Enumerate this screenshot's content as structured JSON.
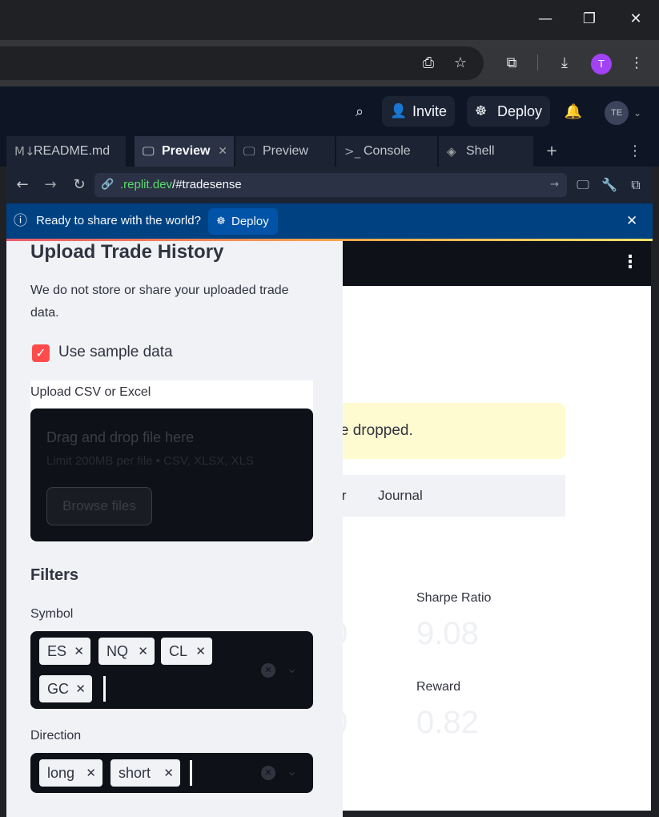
{
  "replit": {
    "invite_label": "Invite",
    "deploy_label": "Deploy",
    "avatar_initials": "TE",
    "tabs": [
      {
        "label": "README.md"
      },
      {
        "label": "Preview"
      },
      {
        "label": "Preview"
      },
      {
        "label": "Console"
      },
      {
        "label": "Shell"
      }
    ],
    "url_host": ".replit.dev",
    "url_path": "/#tradesense"
  },
  "browser": {
    "profile_initial": "T"
  },
  "banner": {
    "text": "Ready to share with the world?",
    "deploy_label": "Deploy"
  },
  "sidebar": {
    "title": "Upload Trade History",
    "note": "We do not store or share your uploaded trade data.",
    "sample_checkbox_label": "Use sample data",
    "sample_checked": true,
    "upload_label": "Upload CSV or Excel",
    "dropzone_title": "Drag and drop file here",
    "dropzone_limit": "Limit 200MB per file • CSV, XLSX, XLS",
    "browse_label": "Browse files",
    "filters_heading": "Filters",
    "symbol_label": "Symbol",
    "symbols": [
      "ES",
      "NQ",
      "CL",
      "GC"
    ],
    "direction_label": "Direction",
    "directions": [
      "long",
      "short"
    ]
  },
  "main": {
    "warning_partial": "ere dropped.",
    "tab_partial": "dar",
    "tab_journal": "Journal",
    "metric1_label": "Sharpe Ratio",
    "metric1_value": "9.08",
    "metric2_label": "Reward",
    "metric2_value": "0.82",
    "metric_left_partial_1": "0",
    "metric_left_partial_2": "0"
  },
  "colors": {
    "accent": "#ff4b4b",
    "banner": "#004182",
    "replit_bg": "#0e1525"
  }
}
